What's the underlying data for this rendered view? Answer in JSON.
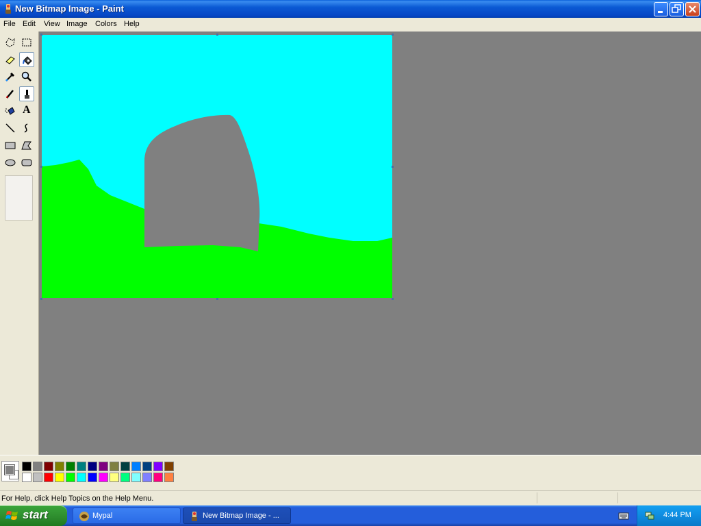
{
  "window": {
    "title": "New Bitmap Image - Paint",
    "icon": "paint-app-icon",
    "controls": [
      "minimize-icon",
      "restore-icon",
      "close-icon"
    ]
  },
  "menu": {
    "items": [
      {
        "label": "File"
      },
      {
        "label": "Edit"
      },
      {
        "label": "View"
      },
      {
        "label": "Image"
      },
      {
        "label": "Colors"
      },
      {
        "label": "Help"
      }
    ]
  },
  "toolbox": {
    "tools": [
      {
        "name": "free-form-select",
        "icon": "free-form-select-icon",
        "selected": false
      },
      {
        "name": "select",
        "icon": "rectangle-select-icon",
        "selected": false
      },
      {
        "name": "eraser",
        "icon": "eraser-icon",
        "selected": false
      },
      {
        "name": "fill-with-color",
        "icon": "paint-bucket-icon",
        "selected": true
      },
      {
        "name": "pick-color",
        "icon": "eyedropper-icon",
        "selected": false
      },
      {
        "name": "magnifier",
        "icon": "magnifier-icon",
        "selected": false
      },
      {
        "name": "pencil",
        "icon": "pencil-icon",
        "selected": false
      },
      {
        "name": "brush",
        "icon": "brush-icon",
        "selected": true
      },
      {
        "name": "airbrush",
        "icon": "airbrush-icon",
        "selected": false
      },
      {
        "name": "text",
        "icon": "text-icon",
        "selected": false
      },
      {
        "name": "line",
        "icon": "line-icon",
        "selected": false
      },
      {
        "name": "curve",
        "icon": "curve-icon",
        "selected": false
      },
      {
        "name": "rectangle",
        "icon": "rectangle-icon",
        "selected": false
      },
      {
        "name": "polygon",
        "icon": "polygon-icon",
        "selected": false
      },
      {
        "name": "ellipse",
        "icon": "ellipse-icon",
        "selected": false
      },
      {
        "name": "rounded-rectangle",
        "icon": "rounded-rectangle-icon",
        "selected": false
      }
    ],
    "text_tool_glyph": "A"
  },
  "canvas": {
    "sky_color": "#00ffff",
    "ground_color": "#00ff00",
    "shape_color": "#808080"
  },
  "colors": {
    "foreground": "#808080",
    "background": "#ffffff",
    "palette_top": [
      "#000000",
      "#808080",
      "#800000",
      "#808000",
      "#008000",
      "#008080",
      "#000080",
      "#800080",
      "#808040",
      "#004040",
      "#0080ff",
      "#004080",
      "#8000ff",
      "#804000"
    ],
    "palette_bottom": [
      "#ffffff",
      "#c0c0c0",
      "#ff0000",
      "#ffff00",
      "#00ff00",
      "#00ffff",
      "#0000ff",
      "#ff00ff",
      "#ffff80",
      "#00ff80",
      "#80ffff",
      "#8080ff",
      "#ff0080",
      "#ff8040"
    ]
  },
  "status": {
    "help_text": "For Help, click Help Topics on the Help Menu."
  },
  "taskbar": {
    "start_label": "start",
    "tasks": [
      {
        "label": "Mypal",
        "icon": "mypal-browser-icon",
        "active": false
      },
      {
        "label": "New Bitmap Image - ...",
        "icon": "paint-app-icon",
        "active": true
      }
    ],
    "clock": "4:44 PM"
  }
}
